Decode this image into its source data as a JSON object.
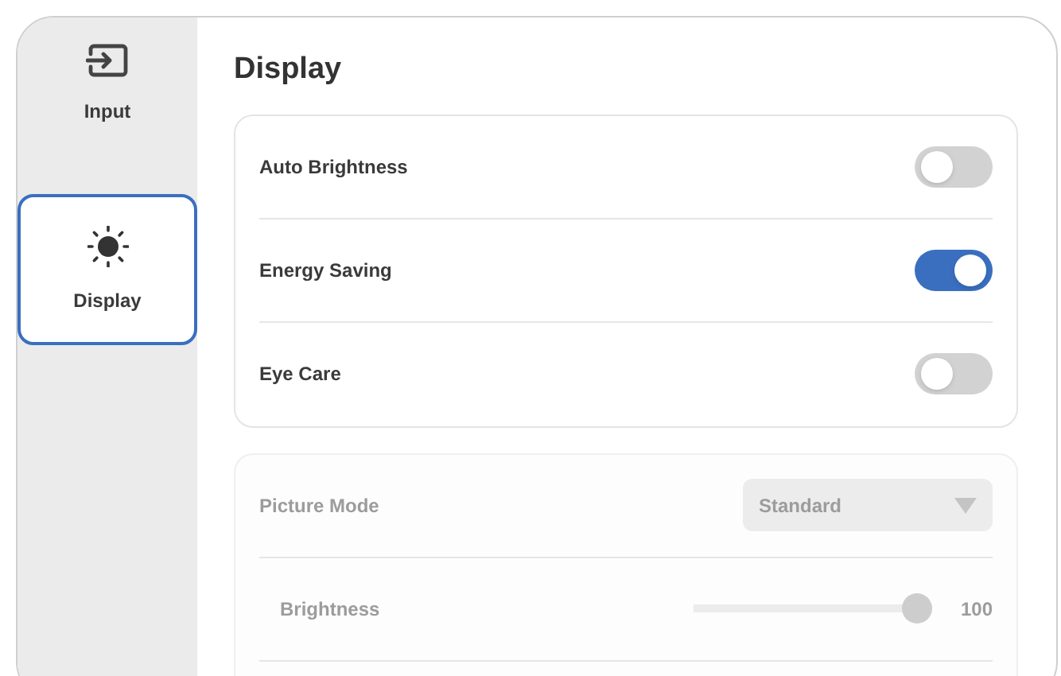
{
  "sidebar": {
    "items": [
      {
        "kind": "input",
        "label": "Input",
        "selected": false
      },
      {
        "kind": "display",
        "label": "Display",
        "selected": true
      }
    ]
  },
  "title": "Display",
  "cards": [
    {
      "disabled": false,
      "rows": [
        {
          "kind": "toggle",
          "label": "Auto Brightness",
          "on": false
        },
        {
          "kind": "toggle",
          "label": "Energy Saving",
          "on": true
        },
        {
          "kind": "toggle",
          "label": "Eye Care",
          "on": false
        }
      ]
    },
    {
      "disabled": true,
      "rows": [
        {
          "kind": "select",
          "label": "Picture Mode",
          "value": "Standard"
        },
        {
          "kind": "slider",
          "label": "Brightness",
          "level": 1,
          "reading": "100"
        }
      ]
    }
  ]
}
